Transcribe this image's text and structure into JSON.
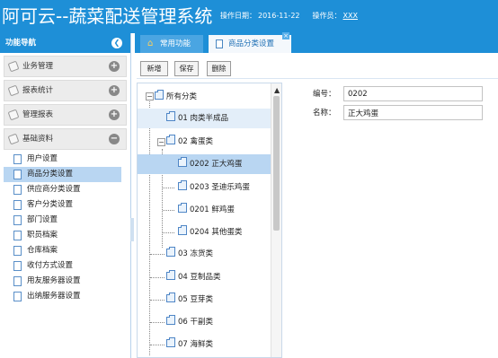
{
  "header": {
    "title": "阿可云--蔬菜配送管理系统",
    "date_label": "操作日期：",
    "date_value": "2016-11-22",
    "operator_label": "操作员：",
    "operator_value": "XXX"
  },
  "sidebar": {
    "title": "功能导航",
    "groups": [
      {
        "label": "业务管理",
        "state": "+"
      },
      {
        "label": "报表统计",
        "state": "+"
      },
      {
        "label": "管理报表",
        "state": "+"
      },
      {
        "label": "基础资料",
        "state": "−"
      }
    ],
    "items": [
      {
        "label": "用户设置"
      },
      {
        "label": "商品分类设置"
      },
      {
        "label": "供应商分类设置"
      },
      {
        "label": "客户分类设置"
      },
      {
        "label": "部门设置"
      },
      {
        "label": "职员档案"
      },
      {
        "label": "仓库档案"
      },
      {
        "label": "收付方式设置"
      },
      {
        "label": "用友服务器设置"
      },
      {
        "label": "出纳服务器设置"
      }
    ]
  },
  "tabs": [
    {
      "label": "常用功能"
    },
    {
      "label": "商品分类设置"
    }
  ],
  "toolbar": {
    "new_label": "新增",
    "save_label": "保存",
    "delete_label": "删除"
  },
  "tree": {
    "root": "所有分类",
    "nodes": [
      {
        "label": "01 肉类半成品"
      },
      {
        "label": "02 禽蛋类"
      },
      {
        "label": "0202 正大鸡蛋"
      },
      {
        "label": "0203 圣迪乐鸡蛋"
      },
      {
        "label": "0201 鲜鸡蛋"
      },
      {
        "label": "0204 其他蛋类"
      },
      {
        "label": "03 冻货类"
      },
      {
        "label": "04 豆制品类"
      },
      {
        "label": "05 豆芽类"
      },
      {
        "label": "06 干副类"
      },
      {
        "label": "07 海鲜类"
      }
    ]
  },
  "form": {
    "code_label": "编号：",
    "code_value": "0202",
    "name_label": "名称：",
    "name_value": "正大鸡蛋"
  },
  "colors": {
    "header_bg": "#1e8fd7",
    "selected_bg": "#b9d6f2"
  }
}
